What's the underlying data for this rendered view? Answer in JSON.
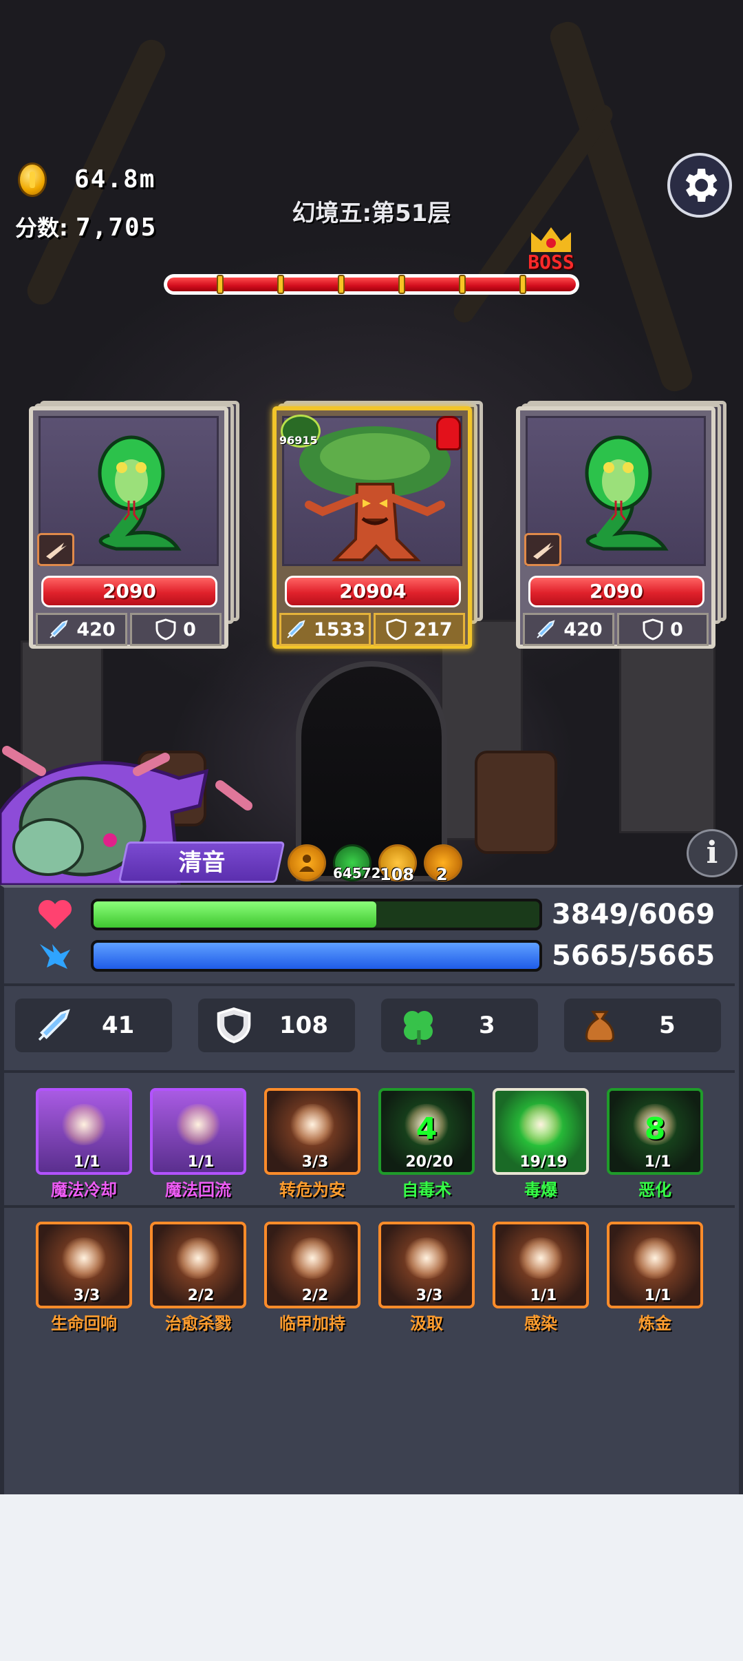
{
  "header": {
    "coins": "64.8m",
    "score_label": "分数:",
    "score_value": "7,705",
    "level_title": "幻境五:第51层",
    "boss_label": "BOSS",
    "icons": [
      "coin-icon",
      "gear-icon",
      "crown-icon"
    ]
  },
  "wave_progress": 1.0,
  "enemies": [
    {
      "name": "snake",
      "hp": "2090",
      "attack": "420",
      "defense": "0"
    },
    {
      "name": "tree-boss",
      "badge": "96915",
      "hp": "20904",
      "attack": "1533",
      "defense": "217"
    },
    {
      "name": "snake",
      "hp": "2090",
      "attack": "420",
      "defense": "0"
    }
  ],
  "hero": {
    "name": "清音",
    "buffs": [
      "",
      "64572",
      "108",
      "2"
    ],
    "hp": "3849/6069",
    "hp_ratio": 0.634,
    "mp": "5665/5665",
    "mp_ratio": 1.0
  },
  "player_stats": {
    "attack": "41",
    "defense": "108",
    "luck": "3",
    "bag": "5"
  },
  "skills_row1": [
    {
      "name": "魔法冷却",
      "count": "1/1",
      "style": "purple"
    },
    {
      "name": "魔法回流",
      "count": "1/1",
      "style": "purple"
    },
    {
      "name": "转危为安",
      "count": "3/3",
      "style": "orange"
    },
    {
      "name": "自毒术",
      "count": "20/20",
      "big": "4",
      "style": "green"
    },
    {
      "name": "毒爆",
      "count": "19/19",
      "style": "green active"
    },
    {
      "name": "恶化",
      "count": "1/1",
      "big": "8",
      "style": "green"
    }
  ],
  "skills_row2": [
    {
      "name": "生命回响",
      "count": "3/3",
      "style": "orange"
    },
    {
      "name": "治愈杀戮",
      "count": "2/2",
      "style": "orange"
    },
    {
      "name": "临甲加持",
      "count": "2/2",
      "style": "orange"
    },
    {
      "name": "汲取",
      "count": "3/3",
      "style": "orange"
    },
    {
      "name": "感染",
      "count": "1/1",
      "style": "orange"
    },
    {
      "name": "炼金",
      "count": "1/1",
      "style": "orange"
    }
  ],
  "colors": {
    "hp_green": "#52e043",
    "mp_blue": "#1f63f0",
    "boss_red": "#e0212b",
    "gold": "#f2c52a"
  }
}
